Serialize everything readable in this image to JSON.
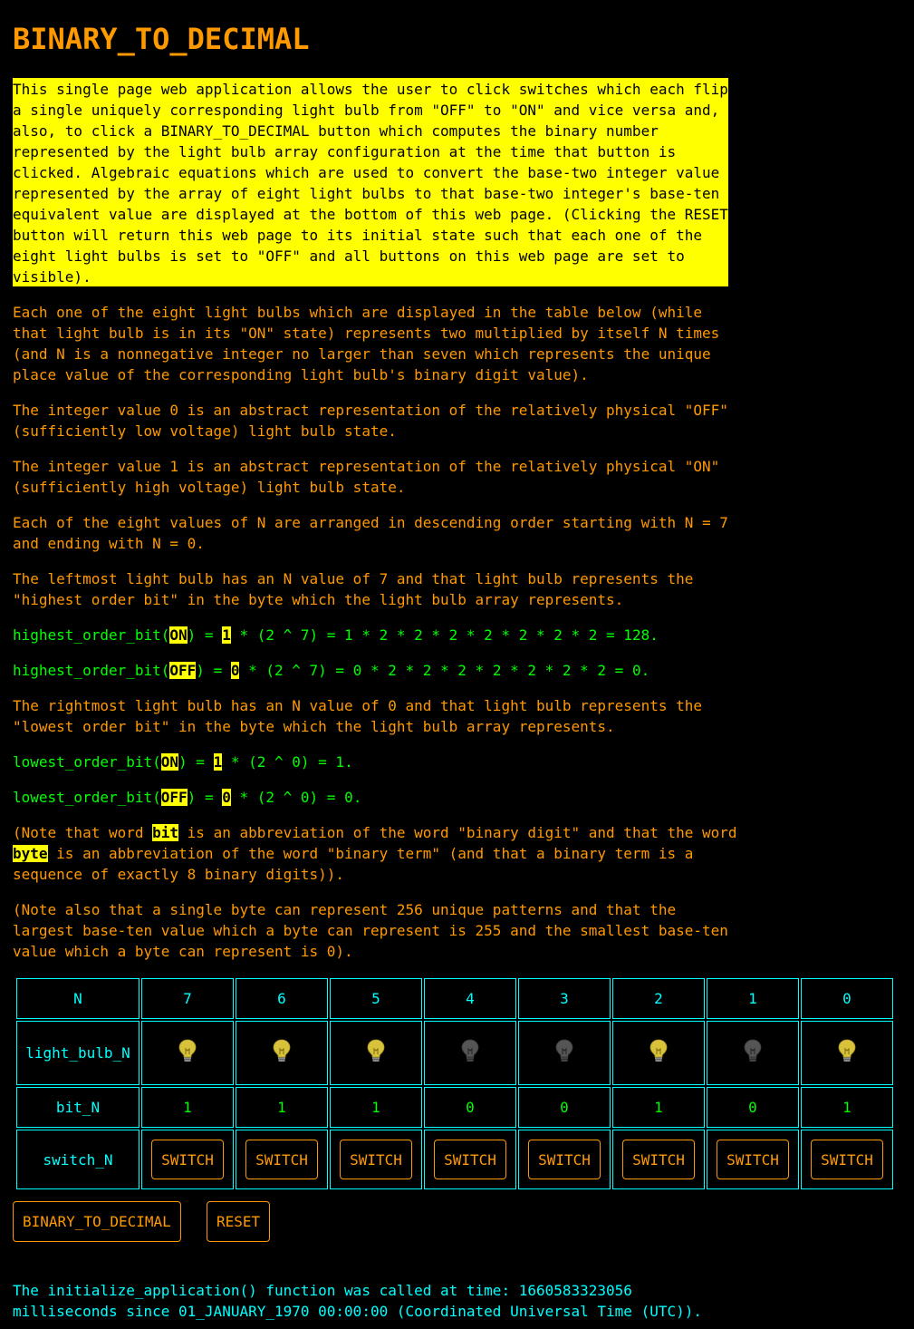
{
  "title": "BINARY_TO_DECIMAL",
  "intro": "This single page web application allows the user to click switches which each flip a single uniquely corresponding light bulb from \"OFF\" to \"ON\" and vice versa and, also, to click a BINARY_TO_DECIMAL button which computes the binary number represented by the light bulb array configuration at the time that button is clicked. Algebraic equations which are used to convert the base-two integer value represented by the array of eight light bulbs to that base-two integer's base-ten equivalent value are displayed at the bottom of this web page. (Clicking the RESET button will return this web page to its initial state such that each one of the eight light bulbs is set to \"OFF\" and all buttons on this web page are set to visible).",
  "para1": "Each one of the eight light bulbs which are displayed in the table below (while that light bulb is in its \"ON\" state) represents two multiplied by itself N times (and N is a nonnegative integer no larger than seven which represents the unique place value of the corresponding light bulb's binary digit value).",
  "para2": "The integer value 0 is an abstract representation of the relatively physical \"OFF\" (sufficiently low voltage) light bulb state.",
  "para3": "The integer value 1 is an abstract representation of the relatively physical \"ON\" (sufficiently high voltage) light bulb state.",
  "para4": "Each of the eight values of N are arranged in descending order starting with N = 7 and ending with N = 0.",
  "para5": "The leftmost light bulb has an N value of 7 and that light bulb represents the \"highest order bit\" in the byte which the light bulb array represents.",
  "eq_high_on": {
    "prefix": "highest_order_bit(",
    "state": "ON",
    "mid": ") = ",
    "digit": "1",
    "rest": " * (2 ^ 7) = 1 * 2 * 2 * 2 * 2 * 2 * 2 * 2 = 128."
  },
  "eq_high_off": {
    "prefix": "highest_order_bit(",
    "state": "OFF",
    "mid": ") = ",
    "digit": "0",
    "rest": " * (2 ^ 7) = 0 * 2 * 2 * 2 * 2 * 2 * 2 * 2 = 0."
  },
  "para6": "The rightmost light bulb has an N value of 0 and that light bulb represents the \"lowest order bit\" in the byte which the light bulb array represents.",
  "eq_low_on": {
    "prefix": "lowest_order_bit(",
    "state": "ON",
    "mid": ") = ",
    "digit": "1",
    "rest": " * (2 ^ 0) = 1."
  },
  "eq_low_off": {
    "prefix": "lowest_order_bit(",
    "state": "OFF",
    "mid": ") = ",
    "digit": "0",
    "rest": " * (2 ^ 0) = 0."
  },
  "note1": {
    "a": "(Note that word ",
    "bit": "bit",
    "b": " is an abbreviation of the word \"binary digit\" and that the word ",
    "byte": "byte",
    "c": " is an abbreviation of the word \"binary term\" (and that a binary term is a sequence of exactly 8 binary digits))."
  },
  "note2": "(Note also that a single byte can represent 256 unique patterns and that the largest base-ten value which a byte can represent is 255 and the smallest base-ten value which a byte can represent is 0).",
  "table": {
    "row_labels": {
      "n": "N",
      "bulb": "light_bulb_N",
      "bit": "bit_N",
      "switch": "switch_N"
    },
    "n_values": [
      "7",
      "6",
      "5",
      "4",
      "3",
      "2",
      "1",
      "0"
    ],
    "bits": [
      "1",
      "1",
      "1",
      "0",
      "0",
      "1",
      "0",
      "1"
    ],
    "switch_label": "SWITCH"
  },
  "colors": {
    "bulb_on": "#d8c23a",
    "bulb_off": "#555555",
    "accent": "#ff9900",
    "table_border": "#00ffff"
  },
  "buttons": {
    "convert": "BINARY_TO_DECIMAL",
    "reset": "RESET"
  },
  "footer": "The initialize_application() function was called at time: 1660583323056 milliseconds since 01_JANUARY_1970 00:00:00 (Coordinated Universal Time (UTC))."
}
